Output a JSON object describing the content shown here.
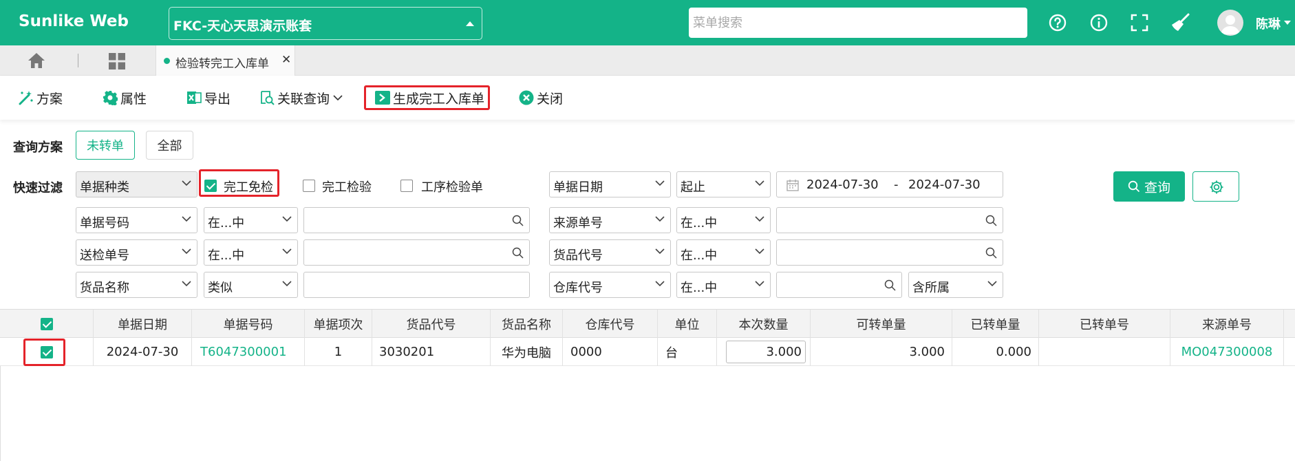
{
  "app": {
    "brand": "Sunlike Web",
    "account": "FKC-天心天思演示账套",
    "menu_search_placeholder": "菜单搜索",
    "username": "陈琳",
    "accent": "#14b388",
    "highlight": "#e4232a"
  },
  "tabs": {
    "active_label": "检验转完工入库单",
    "close_glyph": "✕"
  },
  "toolbar": {
    "scheme": "方案",
    "props": "属性",
    "export": "导出",
    "related": "关联查询",
    "generate": "生成完工入库单",
    "close": "关闭"
  },
  "filters": {
    "scheme_label": "查询方案",
    "scheme_options": [
      "未转单",
      "全部"
    ],
    "quick_label": "快速过滤",
    "row1": {
      "field": "单据种类",
      "checks": [
        {
          "label": "完工免检",
          "checked": true
        },
        {
          "label": "完工检验",
          "checked": false
        },
        {
          "label": "工序检验单",
          "checked": false
        }
      ],
      "date_field": "单据日期",
      "date_op": "起止",
      "date_from": "2024-07-30",
      "date_sep": "-",
      "date_to": "2024-07-30",
      "query_label": "查询"
    },
    "row2": {
      "field": "单据号码",
      "op": "在...中",
      "field2": "来源单号",
      "op2": "在...中"
    },
    "row3": {
      "field": "送检单号",
      "op": "在...中",
      "field2": "货品代号",
      "op2": "在...中"
    },
    "row4": {
      "field": "货品名称",
      "op": "类似",
      "field2": "仓库代号",
      "op2": "在...中",
      "extra": "含所属"
    }
  },
  "grid": {
    "headers": [
      "单据日期",
      "单据号码",
      "单据项次",
      "货品代号",
      "货品名称",
      "仓库代号",
      "单位",
      "本次数量",
      "可转单量",
      "已转单量",
      "已转单号",
      "来源单号"
    ],
    "rows": [
      {
        "checked": true,
        "date": "2024-07-30",
        "doc_no": "T6047300001",
        "item": "1",
        "product_code": "3030201",
        "product_name": "华为电脑",
        "warehouse": "0000",
        "unit": "台",
        "qty": "3.000",
        "convertible": "3.000",
        "converted": "0.000",
        "converted_no": "",
        "source_no": "MO047300008"
      }
    ]
  }
}
